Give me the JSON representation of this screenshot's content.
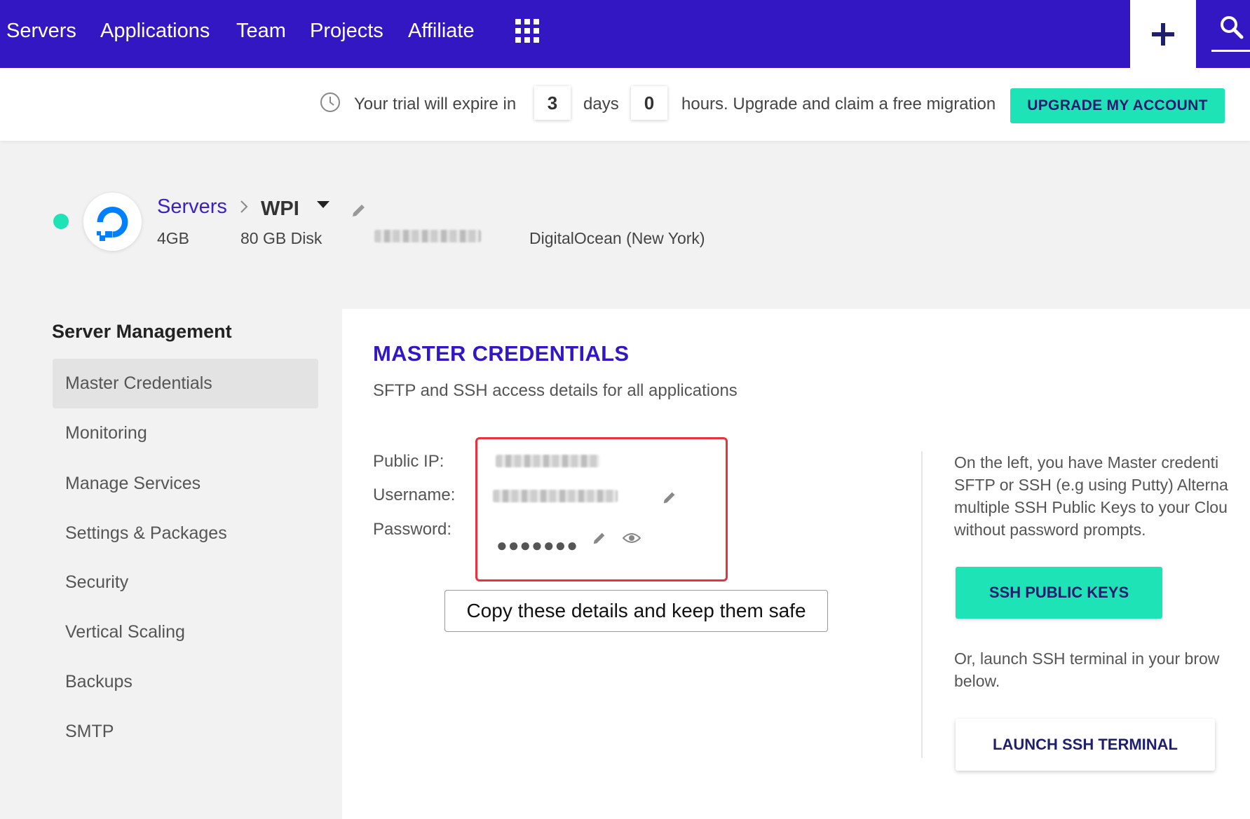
{
  "nav": {
    "items": [
      "Servers",
      "Applications",
      "Team",
      "Projects",
      "Affiliate"
    ],
    "apps_icon": "apps-grid-icon",
    "add_icon": "plus-icon",
    "search_icon": "search-icon"
  },
  "trial": {
    "prefix": "Your trial will expire in",
    "days_value": "3",
    "days_label": "days",
    "hours_value": "0",
    "hours_suffix": "hours. Upgrade and claim a free migration",
    "upgrade_label": "UPGRADE MY ACCOUNT"
  },
  "server": {
    "status": "running",
    "breadcrumb_root": "Servers",
    "name": "WPI",
    "ram": "4GB",
    "disk": "80 GB Disk",
    "provider": "DigitalOcean (New York)"
  },
  "sidebar": {
    "title": "Server Management",
    "items": [
      {
        "label": "Master Credentials",
        "active": true
      },
      {
        "label": "Monitoring"
      },
      {
        "label": "Manage Services"
      },
      {
        "label": "Settings & Packages"
      },
      {
        "label": "Security"
      },
      {
        "label": "Vertical Scaling"
      },
      {
        "label": "Backups"
      },
      {
        "label": "SMTP"
      }
    ]
  },
  "credentials": {
    "title": "MASTER CREDENTIALS",
    "subtitle": "SFTP and SSH access details for all applications",
    "public_ip_label": "Public IP:",
    "username_label": "Username:",
    "password_label": "Password:",
    "password_masked": "●●●●●●●",
    "tooltip": "Copy these details and keep them safe",
    "info_text": "On the left, you have Master credenti\nSFTP or SSH (e.g using Putty) Alterna\nmultiple SSH Public Keys to your Clou\nwithout password prompts.",
    "ssh_keys_label": "SSH PUBLIC KEYS",
    "terminal_text": "Or, launch SSH terminal in your brow\nbelow.",
    "launch_label": "LAUNCH SSH TERMINAL"
  },
  "colors": {
    "brand": "#3217c2",
    "accent": "#1ee3b6",
    "highlight": "#e8323e"
  }
}
